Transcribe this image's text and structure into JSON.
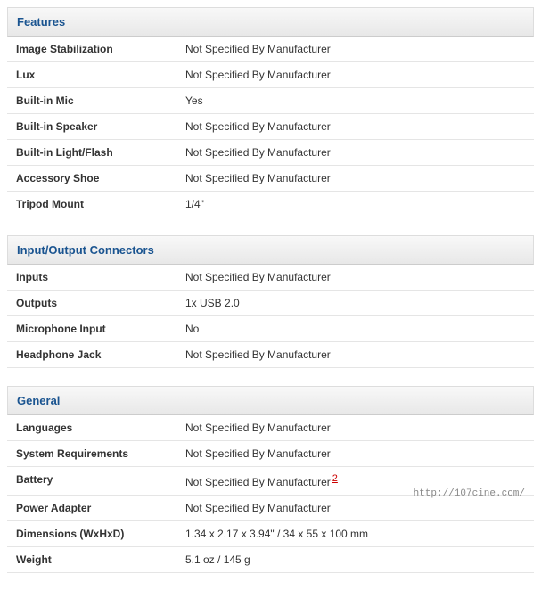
{
  "sections": [
    {
      "title": "Features",
      "rows": [
        {
          "label": "Image Stabilization",
          "value": "Not Specified By Manufacturer"
        },
        {
          "label": "Lux",
          "value": "Not Specified By Manufacturer"
        },
        {
          "label": "Built-in Mic",
          "value": "Yes"
        },
        {
          "label": "Built-in Speaker",
          "value": "Not Specified By Manufacturer"
        },
        {
          "label": "Built-in Light/Flash",
          "value": "Not Specified By Manufacturer"
        },
        {
          "label": "Accessory Shoe",
          "value": "Not Specified By Manufacturer"
        },
        {
          "label": "Tripod Mount",
          "value": "1/4\""
        }
      ]
    },
    {
      "title": "Input/Output Connectors",
      "rows": [
        {
          "label": "Inputs",
          "value": "Not Specified By Manufacturer"
        },
        {
          "label": "Outputs",
          "value": "1x USB 2.0"
        },
        {
          "label": "Microphone Input",
          "value": "No"
        },
        {
          "label": "Headphone Jack",
          "value": "Not Specified By Manufacturer"
        }
      ]
    },
    {
      "title": "General",
      "rows": [
        {
          "label": "Languages",
          "value": "Not Specified By Manufacturer"
        },
        {
          "label": "System Requirements",
          "value": "Not Specified By Manufacturer"
        },
        {
          "label": "Battery",
          "value": "Not Specified By Manufacturer",
          "footnote": "2"
        },
        {
          "label": "Power Adapter",
          "value": "Not Specified By Manufacturer"
        },
        {
          "label": "Dimensions (WxHxD)",
          "value": "1.34 x 2.17 x 3.94\" / 34 x 55 x 100 mm"
        },
        {
          "label": "Weight",
          "value": "5.1 oz / 145 g"
        }
      ]
    }
  ],
  "watermark": "http://107cine.com/"
}
